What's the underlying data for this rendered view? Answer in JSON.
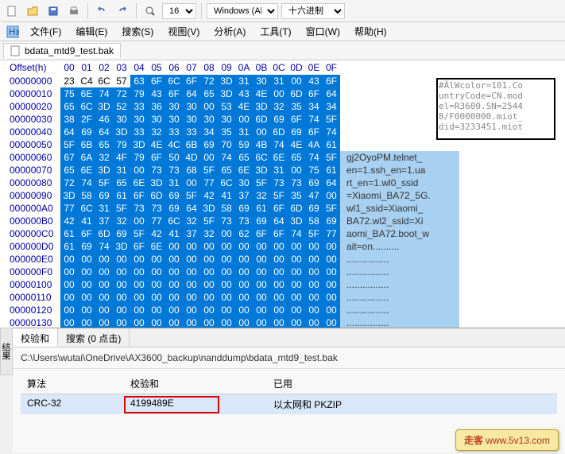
{
  "toolbar": {
    "fontsize": "16",
    "arch": "Windows (Al",
    "encoding": "十六进制"
  },
  "menu": {
    "file": "文件(F)",
    "edit": "编辑(E)",
    "search": "搜索(S)",
    "view": "视图(V)",
    "analyze": "分析(A)",
    "tools": "工具(T)",
    "window": "窗口(W)",
    "help": "帮助(H)"
  },
  "tab": {
    "filename": "bdata_mtd9_test.bak"
  },
  "hex": {
    "offset_header": "Offset(h)",
    "cols": [
      "00",
      "01",
      "02",
      "03",
      "04",
      "05",
      "06",
      "07",
      "08",
      "09",
      "0A",
      "0B",
      "0C",
      "0D",
      "0E",
      "0F"
    ],
    "rows": [
      {
        "off": "00000000",
        "b": [
          "23",
          "C4",
          "6C",
          "57",
          "63",
          "6F",
          "6C",
          "6F",
          "72",
          "3D",
          "31",
          "30",
          "31",
          "00",
          "43",
          "6F"
        ],
        "plain": 4,
        "asc": "#ÄlWcolor=101.Co"
      },
      {
        "off": "00000010",
        "b": [
          "75",
          "6E",
          "74",
          "72",
          "79",
          "43",
          "6F",
          "64",
          "65",
          "3D",
          "43",
          "4E",
          "00",
          "6D",
          "6F",
          "64"
        ],
        "plain": 0,
        "asc": ""
      },
      {
        "off": "00000020",
        "b": [
          "65",
          "6C",
          "3D",
          "52",
          "33",
          "36",
          "30",
          "30",
          "00",
          "53",
          "4E",
          "3D",
          "32",
          "35",
          "34",
          "34"
        ],
        "plain": 0,
        "asc": ""
      },
      {
        "off": "00000030",
        "b": [
          "38",
          "2F",
          "46",
          "30",
          "30",
          "30",
          "30",
          "30",
          "30",
          "30",
          "00",
          "6D",
          "69",
          "6F",
          "74",
          "5F"
        ],
        "plain": 0,
        "asc": ""
      },
      {
        "off": "00000040",
        "b": [
          "64",
          "69",
          "64",
          "3D",
          "33",
          "32",
          "33",
          "33",
          "34",
          "35",
          "31",
          "00",
          "6D",
          "69",
          "6F",
          "74"
        ],
        "plain": 0,
        "asc": ""
      },
      {
        "off": "00000050",
        "b": [
          "5F",
          "6B",
          "65",
          "79",
          "3D",
          "4E",
          "4C",
          "6B",
          "69",
          "70",
          "59",
          "4B",
          "74",
          "4E",
          "4A",
          "61"
        ],
        "plain": 0,
        "asc": ""
      },
      {
        "off": "00000060",
        "b": [
          "67",
          "6A",
          "32",
          "4F",
          "79",
          "6F",
          "50",
          "4D",
          "00",
          "74",
          "65",
          "6C",
          "6E",
          "65",
          "74",
          "5F"
        ],
        "plain": 0,
        "asc": "gj2OyoPM.telnet_"
      },
      {
        "off": "00000070",
        "b": [
          "65",
          "6E",
          "3D",
          "31",
          "00",
          "73",
          "73",
          "68",
          "5F",
          "65",
          "6E",
          "3D",
          "31",
          "00",
          "75",
          "61"
        ],
        "plain": 0,
        "asc": "en=1.ssh_en=1.ua"
      },
      {
        "off": "00000080",
        "b": [
          "72",
          "74",
          "5F",
          "65",
          "6E",
          "3D",
          "31",
          "00",
          "77",
          "6C",
          "30",
          "5F",
          "73",
          "73",
          "69",
          "64"
        ],
        "plain": 0,
        "asc": "rt_en=1.wl0_ssid"
      },
      {
        "off": "00000090",
        "b": [
          "3D",
          "58",
          "69",
          "61",
          "6F",
          "6D",
          "69",
          "5F",
          "42",
          "41",
          "37",
          "32",
          "5F",
          "35",
          "47",
          "00"
        ],
        "plain": 0,
        "asc": "=Xiaomi_BA72_5G."
      },
      {
        "off": "000000A0",
        "b": [
          "77",
          "6C",
          "31",
          "5F",
          "73",
          "73",
          "69",
          "64",
          "3D",
          "58",
          "69",
          "61",
          "6F",
          "6D",
          "69",
          "5F"
        ],
        "plain": 0,
        "asc": "wl1_ssid=Xiaomi_"
      },
      {
        "off": "000000B0",
        "b": [
          "42",
          "41",
          "37",
          "32",
          "00",
          "77",
          "6C",
          "32",
          "5F",
          "73",
          "73",
          "69",
          "64",
          "3D",
          "58",
          "69"
        ],
        "plain": 0,
        "asc": "BA72.wl2_ssid=Xi"
      },
      {
        "off": "000000C0",
        "b": [
          "61",
          "6F",
          "6D",
          "69",
          "5F",
          "42",
          "41",
          "37",
          "32",
          "00",
          "62",
          "6F",
          "6F",
          "74",
          "5F",
          "77"
        ],
        "plain": 0,
        "asc": "aomi_BA72.boot_w"
      },
      {
        "off": "000000D0",
        "b": [
          "61",
          "69",
          "74",
          "3D",
          "6F",
          "6E",
          "00",
          "00",
          "00",
          "00",
          "00",
          "00",
          "00",
          "00",
          "00",
          "00"
        ],
        "plain": 0,
        "asc": "ait=on.........."
      },
      {
        "off": "000000E0",
        "b": [
          "00",
          "00",
          "00",
          "00",
          "00",
          "00",
          "00",
          "00",
          "00",
          "00",
          "00",
          "00",
          "00",
          "00",
          "00",
          "00"
        ],
        "plain": 0,
        "asc": "................"
      },
      {
        "off": "000000F0",
        "b": [
          "00",
          "00",
          "00",
          "00",
          "00",
          "00",
          "00",
          "00",
          "00",
          "00",
          "00",
          "00",
          "00",
          "00",
          "00",
          "00"
        ],
        "plain": 0,
        "asc": "................"
      },
      {
        "off": "00000100",
        "b": [
          "00",
          "00",
          "00",
          "00",
          "00",
          "00",
          "00",
          "00",
          "00",
          "00",
          "00",
          "00",
          "00",
          "00",
          "00",
          "00"
        ],
        "plain": 0,
        "asc": "................"
      },
      {
        "off": "00000110",
        "b": [
          "00",
          "00",
          "00",
          "00",
          "00",
          "00",
          "00",
          "00",
          "00",
          "00",
          "00",
          "00",
          "00",
          "00",
          "00",
          "00"
        ],
        "plain": 0,
        "asc": "................"
      },
      {
        "off": "00000120",
        "b": [
          "00",
          "00",
          "00",
          "00",
          "00",
          "00",
          "00",
          "00",
          "00",
          "00",
          "00",
          "00",
          "00",
          "00",
          "00",
          "00"
        ],
        "plain": 0,
        "asc": "................"
      },
      {
        "off": "00000130",
        "b": [
          "00",
          "00",
          "00",
          "00",
          "00",
          "00",
          "00",
          "00",
          "00",
          "00",
          "00",
          "00",
          "00",
          "00",
          "00",
          "00"
        ],
        "plain": 0,
        "asc": "................"
      }
    ]
  },
  "vtab": "结果",
  "bottom": {
    "tab1": "校验和",
    "tab2": "搜索 (0 点击)",
    "path": "C:\\Users\\wutai\\OneDrive\\AX3600_backup\\nanddump\\bdata_mtd9_test.bak",
    "col_algo": "算法",
    "col_sum": "校验和",
    "col_used": "已用",
    "algo": "CRC-32",
    "sum": "4199489E",
    "used": "以太网和 PKZIP"
  },
  "watermark": {
    "a": "走客",
    "b": "www.5v13.com"
  }
}
